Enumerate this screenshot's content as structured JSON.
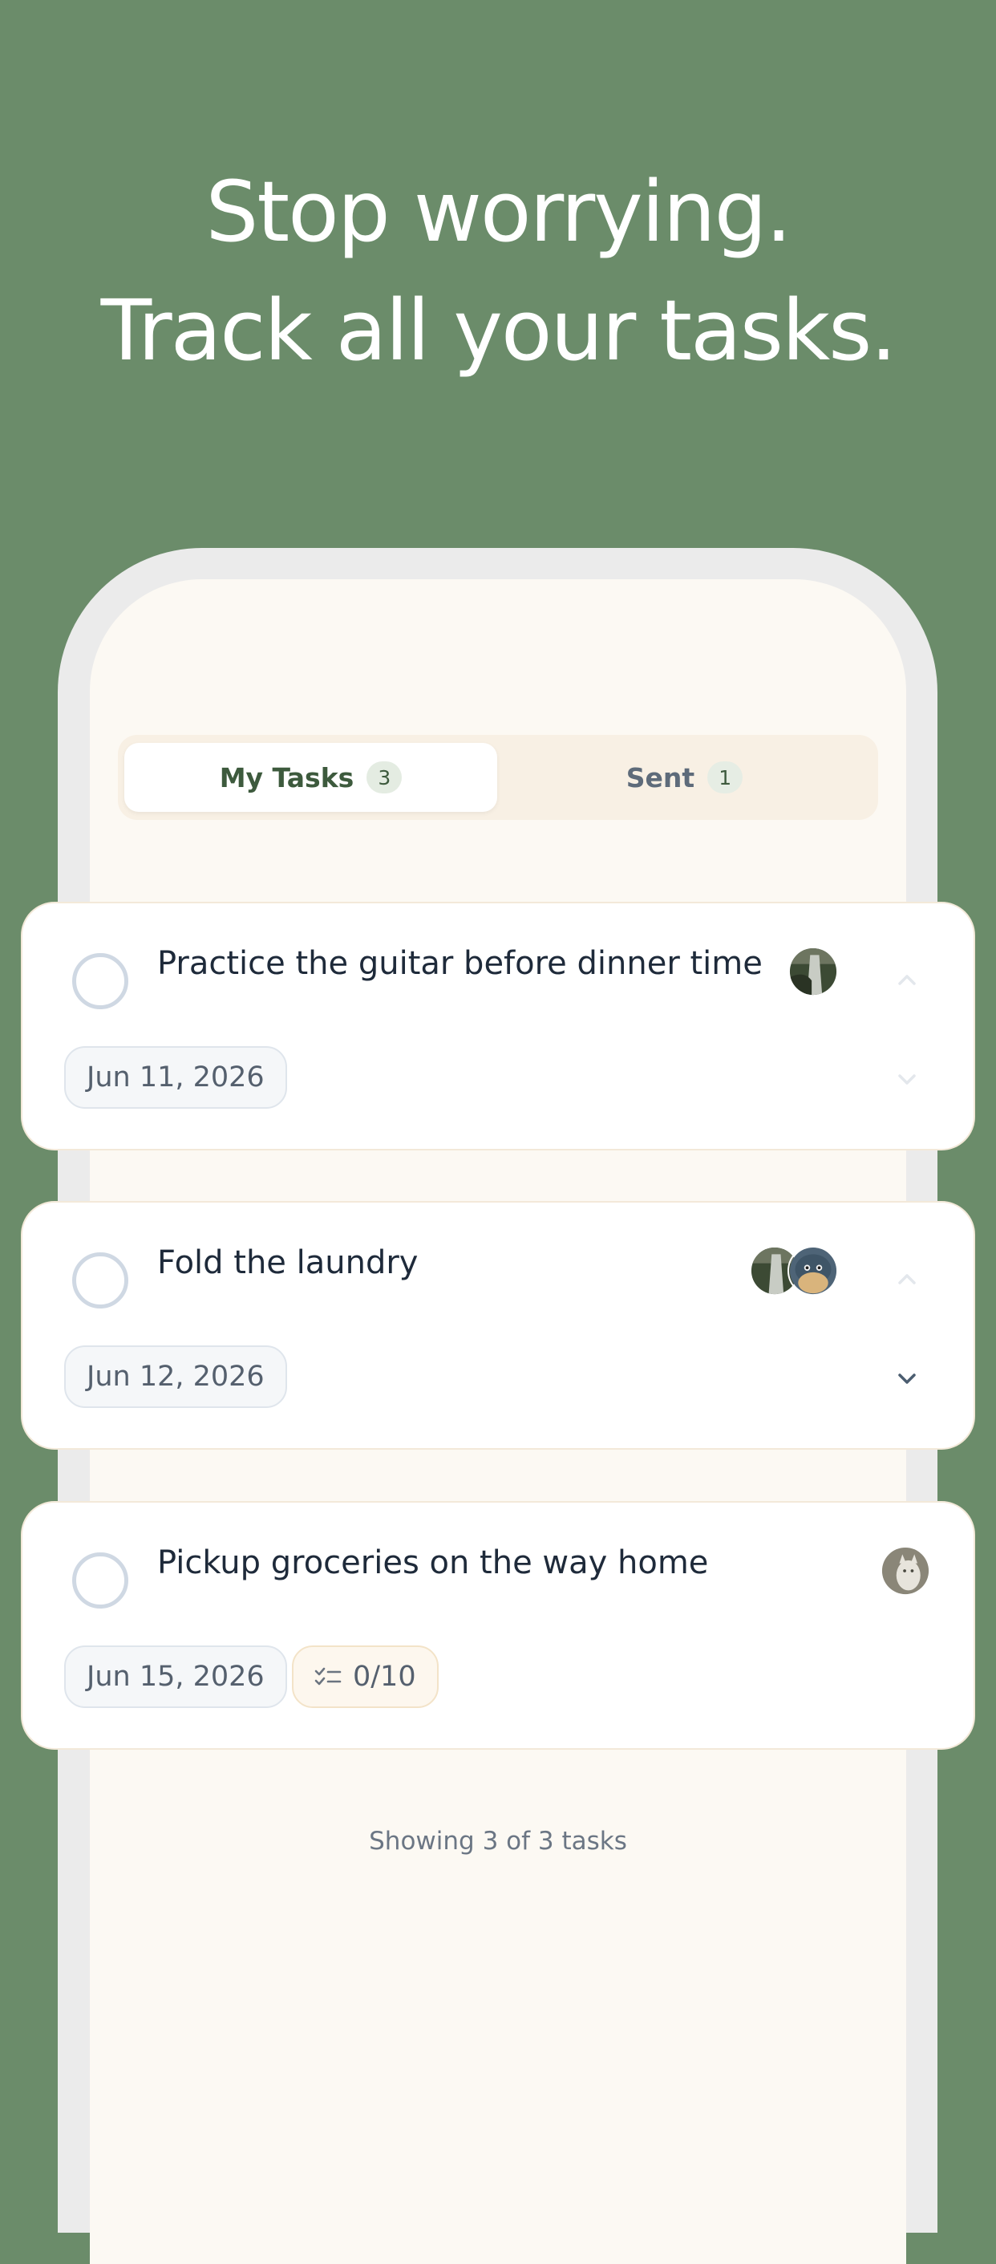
{
  "headline": {
    "line1": "Stop worrying.",
    "line2": "Track all your tasks."
  },
  "tabs": [
    {
      "label": "My Tasks",
      "count": "3",
      "active": true
    },
    {
      "label": "Sent",
      "count": "1",
      "active": false
    }
  ],
  "tasks": [
    {
      "title": "Practice the guitar before dinner time",
      "date": "Jun 11, 2026",
      "avatars": [
        "waterfall-avatar"
      ]
    },
    {
      "title": "Fold the laundry",
      "date": "Jun 12, 2026",
      "avatars": [
        "waterfall-avatar",
        "plush-toy-avatar"
      ]
    },
    {
      "title": "Pickup groceries on the way home",
      "date": "Jun 15, 2026",
      "subtasks": "0/10",
      "avatars": [
        "cat-avatar"
      ]
    }
  ],
  "footer": {
    "summary": "Showing 3 of 3 tasks"
  },
  "colors": {
    "background": "#6b8c6a",
    "screen": "#fcf9f3",
    "accent": "#3d5a3d"
  }
}
